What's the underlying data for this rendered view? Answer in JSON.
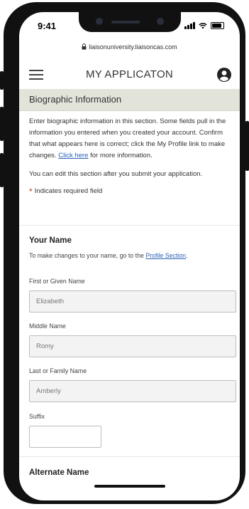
{
  "status_bar": {
    "time": "9:41"
  },
  "browser": {
    "url": "liaisonuniversity.liaisoncas.com"
  },
  "header": {
    "title": "MY APPLICATON"
  },
  "section": {
    "title": "Biographic Information",
    "intro_text": "Enter biographic information in this section. Some fields pull in the information you entered when you created your account. Confirm that what appears here is correct; click the My Profile link to make changes.",
    "intro_link": "Click here",
    "intro_tail": "for more information.",
    "edit_note": "You can edit this section after you submit your application.",
    "required_star": "*",
    "required_note": "Indicates required field"
  },
  "your_name": {
    "heading": "Your Name",
    "help_prefix": "To make changes to your name, go to the",
    "help_link": "Profile Section",
    "help_suffix": "."
  },
  "fields": {
    "first": {
      "label": "First or Given Name",
      "value": "Elizabeth"
    },
    "middle": {
      "label": "Middle Name",
      "value": "Romy"
    },
    "last": {
      "label": "Last or Family Name",
      "value": "Amberly"
    },
    "suffix": {
      "label": "Suffix",
      "value": ""
    }
  },
  "alternate_name": {
    "heading": "Alternate Name"
  }
}
